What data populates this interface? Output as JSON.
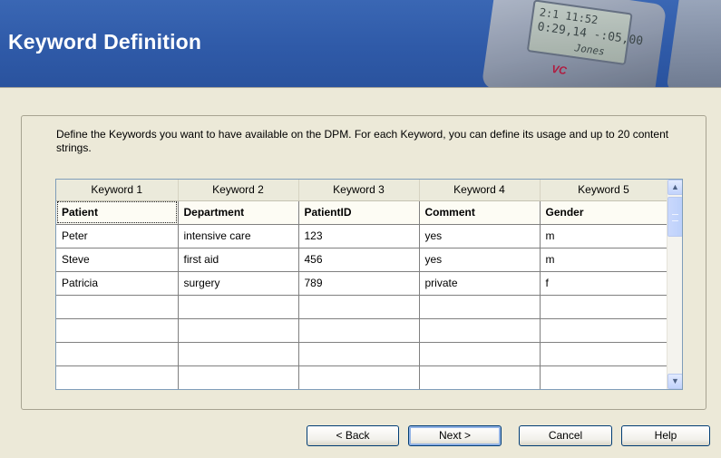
{
  "wizard": {
    "title": "Keyword Definition",
    "description": "Define the Keywords you want to have available on the DPM. For each Keyword, you can define its usage and up to 20 content strings.",
    "header_device": {
      "line1": "0:29,14  -:05,00",
      "line2": "Jones",
      "line_top": "2:1         11:52",
      "brand": "VC"
    }
  },
  "keyword_table": {
    "columns": [
      "Keyword 1",
      "Keyword 2",
      "Keyword 3",
      "Keyword 4",
      "Keyword 5"
    ],
    "keyword_names": [
      "Patient",
      "Department",
      "PatientID",
      "Comment",
      "Gender"
    ],
    "rows": [
      [
        "Peter",
        "intensive care",
        "123",
        "yes",
        "m"
      ],
      [
        "Steve",
        "first aid",
        "456",
        "yes",
        "m"
      ],
      [
        "Patricia",
        "surgery",
        "789",
        "private",
        "f"
      ],
      [
        "",
        "",
        "",
        "",
        ""
      ],
      [
        "",
        "",
        "",
        "",
        ""
      ],
      [
        "",
        "",
        "",
        "",
        ""
      ],
      [
        "",
        "",
        "",
        "",
        ""
      ]
    ]
  },
  "scrollbar": {
    "up_icon": "chevron-up-icon",
    "down_icon": "chevron-down-icon"
  },
  "buttons": {
    "back": "< Back",
    "next": "Next >",
    "cancel": "Cancel",
    "help": "Help"
  }
}
